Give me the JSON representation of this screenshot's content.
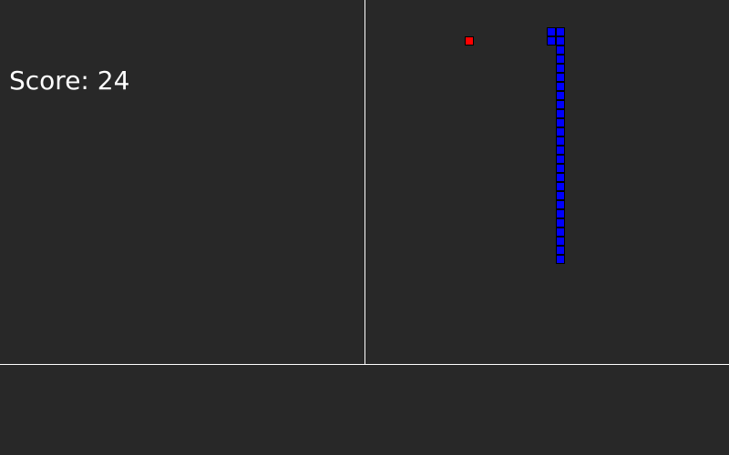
{
  "score": {
    "text": "Score: 24"
  },
  "colors": {
    "background": "#282828",
    "divider": "#ffffff",
    "snake": "#0000ff",
    "food": "#ff0000",
    "cell_border": "#000000"
  },
  "grid": {
    "cell_size": 10,
    "columns": 40,
    "rows": 40
  },
  "food": {
    "col": 11,
    "row": 4
  },
  "snake": {
    "segments": [
      {
        "col": 20,
        "row": 3
      },
      {
        "col": 21,
        "row": 3
      },
      {
        "col": 21,
        "row": 4
      },
      {
        "col": 20,
        "row": 4
      },
      {
        "col": 21,
        "row": 5
      },
      {
        "col": 21,
        "row": 6
      },
      {
        "col": 21,
        "row": 7
      },
      {
        "col": 21,
        "row": 8
      },
      {
        "col": 21,
        "row": 9
      },
      {
        "col": 21,
        "row": 10
      },
      {
        "col": 21,
        "row": 11
      },
      {
        "col": 21,
        "row": 12
      },
      {
        "col": 21,
        "row": 13
      },
      {
        "col": 21,
        "row": 14
      },
      {
        "col": 21,
        "row": 15
      },
      {
        "col": 21,
        "row": 16
      },
      {
        "col": 21,
        "row": 17
      },
      {
        "col": 21,
        "row": 18
      },
      {
        "col": 21,
        "row": 19
      },
      {
        "col": 21,
        "row": 20
      },
      {
        "col": 21,
        "row": 21
      },
      {
        "col": 21,
        "row": 22
      },
      {
        "col": 21,
        "row": 23
      },
      {
        "col": 21,
        "row": 24
      },
      {
        "col": 21,
        "row": 25
      },
      {
        "col": 21,
        "row": 26
      },
      {
        "col": 21,
        "row": 27
      },
      {
        "col": 21,
        "row": 28
      }
    ]
  }
}
